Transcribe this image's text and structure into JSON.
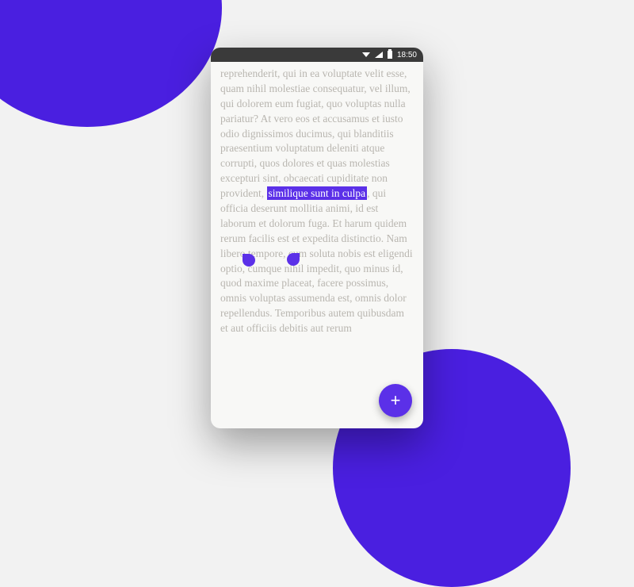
{
  "colors": {
    "accent": "#5b30e8",
    "bg": "#f2f2f2",
    "phone_bg": "#f8f8f6",
    "text_muted": "#b9b6b0"
  },
  "status_bar": {
    "time": "18:50"
  },
  "article": {
    "pre": "reprehenderit, qui in ea voluptate velit esse, quam nihil molestiae consequatur, vel illum, qui dolorem eum fugiat, quo voluptas nulla pariatur? At vero eos et accusamus et iusto odio dignissimos ducimus, qui blanditiis praesentium voluptatum deleniti atque corrupti, quos dolores et quas molestias excepturi sint, obcaecati cupiditate non provident, ",
    "highlight": "similique sunt in culpa",
    "post": ", qui officia deserunt mollitia animi, id est laborum et dolorum fuga. Et harum quidem rerum facilis est et expedita distinctio. Nam libero tempore, cum soluta nobis est eligendi optio, cumque nihil impedit, quo minus id, quod maxime placeat, facere possimus, omnis voluptas assumenda est, omnis dolor repellendus. Temporibus autem quibusdam et aut officiis debitis aut rerum"
  },
  "fab": {
    "label": "+"
  }
}
